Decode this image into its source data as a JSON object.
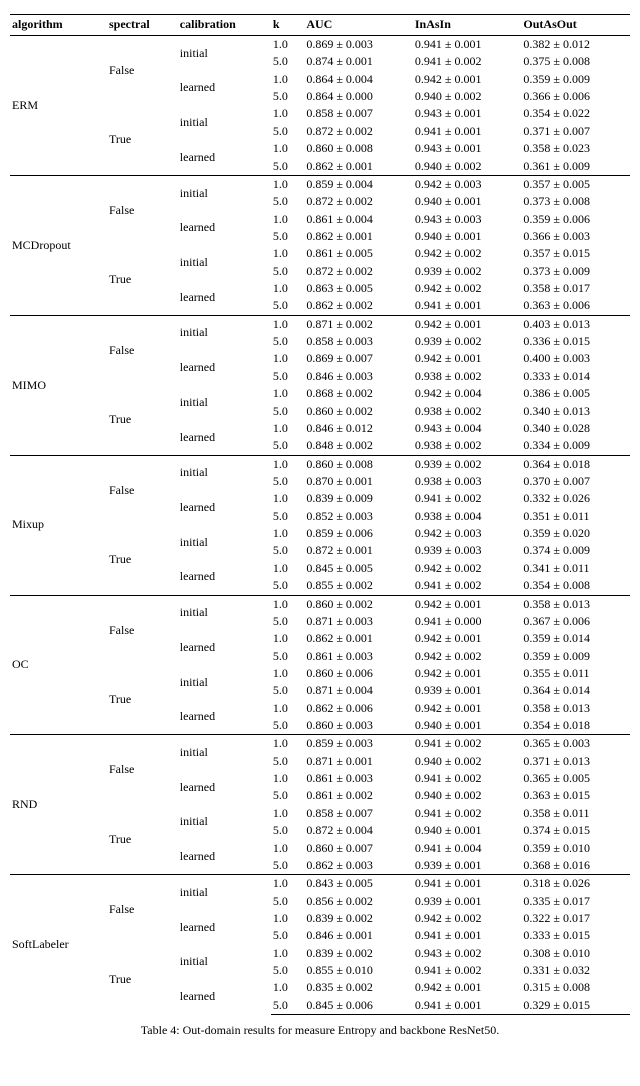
{
  "columns": [
    "algorithm",
    "spectral",
    "calibration",
    "k",
    "AUC",
    "InAsIn",
    "OutAsOut"
  ],
  "caption": "Table 4: Out-domain results for measure Entropy and backbone ResNet50.",
  "algorithms": [
    {
      "name": "ERM",
      "spectrals": [
        {
          "spectral": "False",
          "calibrations": [
            {
              "calibration": "initial",
              "rows": [
                {
                  "k": "1.0",
                  "AUC": "0.869 ± 0.003",
                  "InAsIn": "0.941 ± 0.001",
                  "OutAsOut": "0.382 ± 0.012"
                },
                {
                  "k": "5.0",
                  "AUC": "0.874 ± 0.001",
                  "InAsIn": "0.941 ± 0.002",
                  "OutAsOut": "0.375 ± 0.008"
                }
              ]
            },
            {
              "calibration": "learned",
              "rows": [
                {
                  "k": "1.0",
                  "AUC": "0.864 ± 0.004",
                  "InAsIn": "0.942 ± 0.001",
                  "OutAsOut": "0.359 ± 0.009"
                },
                {
                  "k": "5.0",
                  "AUC": "0.864 ± 0.000",
                  "InAsIn": "0.940 ± 0.002",
                  "OutAsOut": "0.366 ± 0.006"
                }
              ]
            }
          ]
        },
        {
          "spectral": "True",
          "calibrations": [
            {
              "calibration": "initial",
              "rows": [
                {
                  "k": "1.0",
                  "AUC": "0.858 ± 0.007",
                  "InAsIn": "0.943 ± 0.001",
                  "OutAsOut": "0.354 ± 0.022"
                },
                {
                  "k": "5.0",
                  "AUC": "0.872 ± 0.002",
                  "InAsIn": "0.941 ± 0.001",
                  "OutAsOut": "0.371 ± 0.007"
                }
              ]
            },
            {
              "calibration": "learned",
              "rows": [
                {
                  "k": "1.0",
                  "AUC": "0.860 ± 0.008",
                  "InAsIn": "0.943 ± 0.001",
                  "OutAsOut": "0.358 ± 0.023"
                },
                {
                  "k": "5.0",
                  "AUC": "0.862 ± 0.001",
                  "InAsIn": "0.940 ± 0.002",
                  "OutAsOut": "0.361 ± 0.009"
                }
              ]
            }
          ]
        }
      ]
    },
    {
      "name": "MCDropout",
      "spectrals": [
        {
          "spectral": "False",
          "calibrations": [
            {
              "calibration": "initial",
              "rows": [
                {
                  "k": "1.0",
                  "AUC": "0.859 ± 0.004",
                  "InAsIn": "0.942 ± 0.003",
                  "OutAsOut": "0.357 ± 0.005"
                },
                {
                  "k": "5.0",
                  "AUC": "0.872 ± 0.002",
                  "InAsIn": "0.940 ± 0.001",
                  "OutAsOut": "0.373 ± 0.008"
                }
              ]
            },
            {
              "calibration": "learned",
              "rows": [
                {
                  "k": "1.0",
                  "AUC": "0.861 ± 0.004",
                  "InAsIn": "0.943 ± 0.003",
                  "OutAsOut": "0.359 ± 0.006"
                },
                {
                  "k": "5.0",
                  "AUC": "0.862 ± 0.001",
                  "InAsIn": "0.940 ± 0.001",
                  "OutAsOut": "0.366 ± 0.003"
                }
              ]
            }
          ]
        },
        {
          "spectral": "True",
          "calibrations": [
            {
              "calibration": "initial",
              "rows": [
                {
                  "k": "1.0",
                  "AUC": "0.861 ± 0.005",
                  "InAsIn": "0.942 ± 0.002",
                  "OutAsOut": "0.357 ± 0.015"
                },
                {
                  "k": "5.0",
                  "AUC": "0.872 ± 0.002",
                  "InAsIn": "0.939 ± 0.002",
                  "OutAsOut": "0.373 ± 0.009"
                }
              ]
            },
            {
              "calibration": "learned",
              "rows": [
                {
                  "k": "1.0",
                  "AUC": "0.863 ± 0.005",
                  "InAsIn": "0.942 ± 0.002",
                  "OutAsOut": "0.358 ± 0.017"
                },
                {
                  "k": "5.0",
                  "AUC": "0.862 ± 0.002",
                  "InAsIn": "0.941 ± 0.001",
                  "OutAsOut": "0.363 ± 0.006"
                }
              ]
            }
          ]
        }
      ]
    },
    {
      "name": "MIMO",
      "spectrals": [
        {
          "spectral": "False",
          "calibrations": [
            {
              "calibration": "initial",
              "rows": [
                {
                  "k": "1.0",
                  "AUC": "0.871 ± 0.002",
                  "InAsIn": "0.942 ± 0.001",
                  "OutAsOut": "0.403 ± 0.013"
                },
                {
                  "k": "5.0",
                  "AUC": "0.858 ± 0.003",
                  "InAsIn": "0.939 ± 0.002",
                  "OutAsOut": "0.336 ± 0.015"
                }
              ]
            },
            {
              "calibration": "learned",
              "rows": [
                {
                  "k": "1.0",
                  "AUC": "0.869 ± 0.007",
                  "InAsIn": "0.942 ± 0.001",
                  "OutAsOut": "0.400 ± 0.003"
                },
                {
                  "k": "5.0",
                  "AUC": "0.846 ± 0.003",
                  "InAsIn": "0.938 ± 0.002",
                  "OutAsOut": "0.333 ± 0.014"
                }
              ]
            }
          ]
        },
        {
          "spectral": "True",
          "calibrations": [
            {
              "calibration": "initial",
              "rows": [
                {
                  "k": "1.0",
                  "AUC": "0.868 ± 0.002",
                  "InAsIn": "0.942 ± 0.004",
                  "OutAsOut": "0.386 ± 0.005"
                },
                {
                  "k": "5.0",
                  "AUC": "0.860 ± 0.002",
                  "InAsIn": "0.938 ± 0.002",
                  "OutAsOut": "0.340 ± 0.013"
                }
              ]
            },
            {
              "calibration": "learned",
              "rows": [
                {
                  "k": "1.0",
                  "AUC": "0.846 ± 0.012",
                  "InAsIn": "0.943 ± 0.004",
                  "OutAsOut": "0.340 ± 0.028"
                },
                {
                  "k": "5.0",
                  "AUC": "0.848 ± 0.002",
                  "InAsIn": "0.938 ± 0.002",
                  "OutAsOut": "0.334 ± 0.009"
                }
              ]
            }
          ]
        }
      ]
    },
    {
      "name": "Mixup",
      "spectrals": [
        {
          "spectral": "False",
          "calibrations": [
            {
              "calibration": "initial",
              "rows": [
                {
                  "k": "1.0",
                  "AUC": "0.860 ± 0.008",
                  "InAsIn": "0.939 ± 0.002",
                  "OutAsOut": "0.364 ± 0.018"
                },
                {
                  "k": "5.0",
                  "AUC": "0.870 ± 0.001",
                  "InAsIn": "0.938 ± 0.003",
                  "OutAsOut": "0.370 ± 0.007"
                }
              ]
            },
            {
              "calibration": "learned",
              "rows": [
                {
                  "k": "1.0",
                  "AUC": "0.839 ± 0.009",
                  "InAsIn": "0.941 ± 0.002",
                  "OutAsOut": "0.332 ± 0.026"
                },
                {
                  "k": "5.0",
                  "AUC": "0.852 ± 0.003",
                  "InAsIn": "0.938 ± 0.004",
                  "OutAsOut": "0.351 ± 0.011"
                }
              ]
            }
          ]
        },
        {
          "spectral": "True",
          "calibrations": [
            {
              "calibration": "initial",
              "rows": [
                {
                  "k": "1.0",
                  "AUC": "0.859 ± 0.006",
                  "InAsIn": "0.942 ± 0.003",
                  "OutAsOut": "0.359 ± 0.020"
                },
                {
                  "k": "5.0",
                  "AUC": "0.872 ± 0.001",
                  "InAsIn": "0.939 ± 0.003",
                  "OutAsOut": "0.374 ± 0.009"
                }
              ]
            },
            {
              "calibration": "learned",
              "rows": [
                {
                  "k": "1.0",
                  "AUC": "0.845 ± 0.005",
                  "InAsIn": "0.942 ± 0.002",
                  "OutAsOut": "0.341 ± 0.011"
                },
                {
                  "k": "5.0",
                  "AUC": "0.855 ± 0.002",
                  "InAsIn": "0.941 ± 0.002",
                  "OutAsOut": "0.354 ± 0.008"
                }
              ]
            }
          ]
        }
      ]
    },
    {
      "name": "OC",
      "spectrals": [
        {
          "spectral": "False",
          "calibrations": [
            {
              "calibration": "initial",
              "rows": [
                {
                  "k": "1.0",
                  "AUC": "0.860 ± 0.002",
                  "InAsIn": "0.942 ± 0.001",
                  "OutAsOut": "0.358 ± 0.013"
                },
                {
                  "k": "5.0",
                  "AUC": "0.871 ± 0.003",
                  "InAsIn": "0.941 ± 0.000",
                  "OutAsOut": "0.367 ± 0.006"
                }
              ]
            },
            {
              "calibration": "learned",
              "rows": [
                {
                  "k": "1.0",
                  "AUC": "0.862 ± 0.001",
                  "InAsIn": "0.942 ± 0.001",
                  "OutAsOut": "0.359 ± 0.014"
                },
                {
                  "k": "5.0",
                  "AUC": "0.861 ± 0.003",
                  "InAsIn": "0.942 ± 0.002",
                  "OutAsOut": "0.359 ± 0.009"
                }
              ]
            }
          ]
        },
        {
          "spectral": "True",
          "calibrations": [
            {
              "calibration": "initial",
              "rows": [
                {
                  "k": "1.0",
                  "AUC": "0.860 ± 0.006",
                  "InAsIn": "0.942 ± 0.001",
                  "OutAsOut": "0.355 ± 0.011"
                },
                {
                  "k": "5.0",
                  "AUC": "0.871 ± 0.004",
                  "InAsIn": "0.939 ± 0.001",
                  "OutAsOut": "0.364 ± 0.014"
                }
              ]
            },
            {
              "calibration": "learned",
              "rows": [
                {
                  "k": "1.0",
                  "AUC": "0.862 ± 0.006",
                  "InAsIn": "0.942 ± 0.001",
                  "OutAsOut": "0.358 ± 0.013"
                },
                {
                  "k": "5.0",
                  "AUC": "0.860 ± 0.003",
                  "InAsIn": "0.940 ± 0.001",
                  "OutAsOut": "0.354 ± 0.018"
                }
              ]
            }
          ]
        }
      ]
    },
    {
      "name": "RND",
      "spectrals": [
        {
          "spectral": "False",
          "calibrations": [
            {
              "calibration": "initial",
              "rows": [
                {
                  "k": "1.0",
                  "AUC": "0.859 ± 0.003",
                  "InAsIn": "0.941 ± 0.002",
                  "OutAsOut": "0.365 ± 0.003"
                },
                {
                  "k": "5.0",
                  "AUC": "0.871 ± 0.001",
                  "InAsIn": "0.940 ± 0.002",
                  "OutAsOut": "0.371 ± 0.013"
                }
              ]
            },
            {
              "calibration": "learned",
              "rows": [
                {
                  "k": "1.0",
                  "AUC": "0.861 ± 0.003",
                  "InAsIn": "0.941 ± 0.002",
                  "OutAsOut": "0.365 ± 0.005"
                },
                {
                  "k": "5.0",
                  "AUC": "0.861 ± 0.002",
                  "InAsIn": "0.940 ± 0.002",
                  "OutAsOut": "0.363 ± 0.015"
                }
              ]
            }
          ]
        },
        {
          "spectral": "True",
          "calibrations": [
            {
              "calibration": "initial",
              "rows": [
                {
                  "k": "1.0",
                  "AUC": "0.858 ± 0.007",
                  "InAsIn": "0.941 ± 0.002",
                  "OutAsOut": "0.358 ± 0.011"
                },
                {
                  "k": "5.0",
                  "AUC": "0.872 ± 0.004",
                  "InAsIn": "0.940 ± 0.001",
                  "OutAsOut": "0.374 ± 0.015"
                }
              ]
            },
            {
              "calibration": "learned",
              "rows": [
                {
                  "k": "1.0",
                  "AUC": "0.860 ± 0.007",
                  "InAsIn": "0.941 ± 0.004",
                  "OutAsOut": "0.359 ± 0.010"
                },
                {
                  "k": "5.0",
                  "AUC": "0.862 ± 0.003",
                  "InAsIn": "0.939 ± 0.001",
                  "OutAsOut": "0.368 ± 0.016"
                }
              ]
            }
          ]
        }
      ]
    },
    {
      "name": "SoftLabeler",
      "spectrals": [
        {
          "spectral": "False",
          "calibrations": [
            {
              "calibration": "initial",
              "rows": [
                {
                  "k": "1.0",
                  "AUC": "0.843 ± 0.005",
                  "InAsIn": "0.941 ± 0.001",
                  "OutAsOut": "0.318 ± 0.026"
                },
                {
                  "k": "5.0",
                  "AUC": "0.856 ± 0.002",
                  "InAsIn": "0.939 ± 0.001",
                  "OutAsOut": "0.335 ± 0.017"
                }
              ]
            },
            {
              "calibration": "learned",
              "rows": [
                {
                  "k": "1.0",
                  "AUC": "0.839 ± 0.002",
                  "InAsIn": "0.942 ± 0.002",
                  "OutAsOut": "0.322 ± 0.017"
                },
                {
                  "k": "5.0",
                  "AUC": "0.846 ± 0.001",
                  "InAsIn": "0.941 ± 0.001",
                  "OutAsOut": "0.333 ± 0.015"
                }
              ]
            }
          ]
        },
        {
          "spectral": "True",
          "calibrations": [
            {
              "calibration": "initial",
              "rows": [
                {
                  "k": "1.0",
                  "AUC": "0.839 ± 0.002",
                  "InAsIn": "0.943 ± 0.002",
                  "OutAsOut": "0.308 ± 0.010"
                },
                {
                  "k": "5.0",
                  "AUC": "0.855 ± 0.010",
                  "InAsIn": "0.941 ± 0.002",
                  "OutAsOut": "0.331 ± 0.032"
                }
              ]
            },
            {
              "calibration": "learned",
              "rows": [
                {
                  "k": "1.0",
                  "AUC": "0.835 ± 0.002",
                  "InAsIn": "0.942 ± 0.001",
                  "OutAsOut": "0.315 ± 0.008"
                },
                {
                  "k": "5.0",
                  "AUC": "0.845 ± 0.006",
                  "InAsIn": "0.941 ± 0.001",
                  "OutAsOut": "0.329 ± 0.015"
                }
              ]
            }
          ]
        }
      ]
    }
  ]
}
